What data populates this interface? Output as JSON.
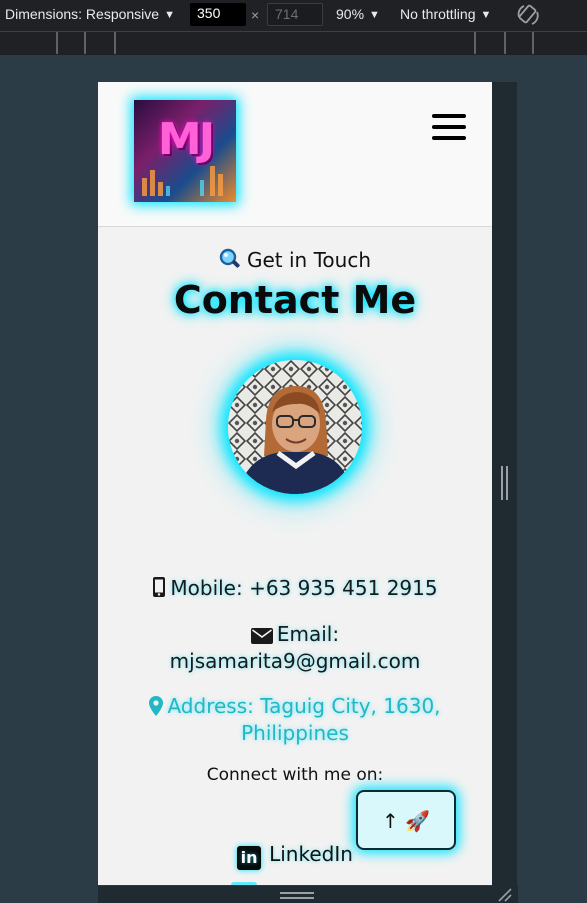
{
  "devtools": {
    "dimensions_label": "Dimensions: Responsive",
    "width_value": "350",
    "height_value": "714",
    "times": "×",
    "zoom": "90%",
    "throttling": "No throttling",
    "caret": "▼"
  },
  "header": {
    "logo_text": "MJ",
    "menu_icon": "hamburger-icon"
  },
  "contact": {
    "intro_text": "Get in Touch",
    "intro_icon": "magnifier-emoji",
    "title": "Contact Me",
    "mobile_label": "Mobile: +63 935 451 2915",
    "email_label": "Email:",
    "email_value": "mjsamarita9@gmail.com",
    "address_line1": "Address: Taguig City, 1630,",
    "address_line2": "Philippines",
    "connect_text": "Connect with me on:",
    "linkedin_label": "LinkedIn"
  },
  "scroll_top": {
    "label": "↑ 🚀"
  },
  "colors": {
    "accent_glow": "#00e5ff",
    "address_color": "#21b7c4",
    "devtools_bg": "#202124",
    "canvas_bg": "#2b3c46"
  }
}
